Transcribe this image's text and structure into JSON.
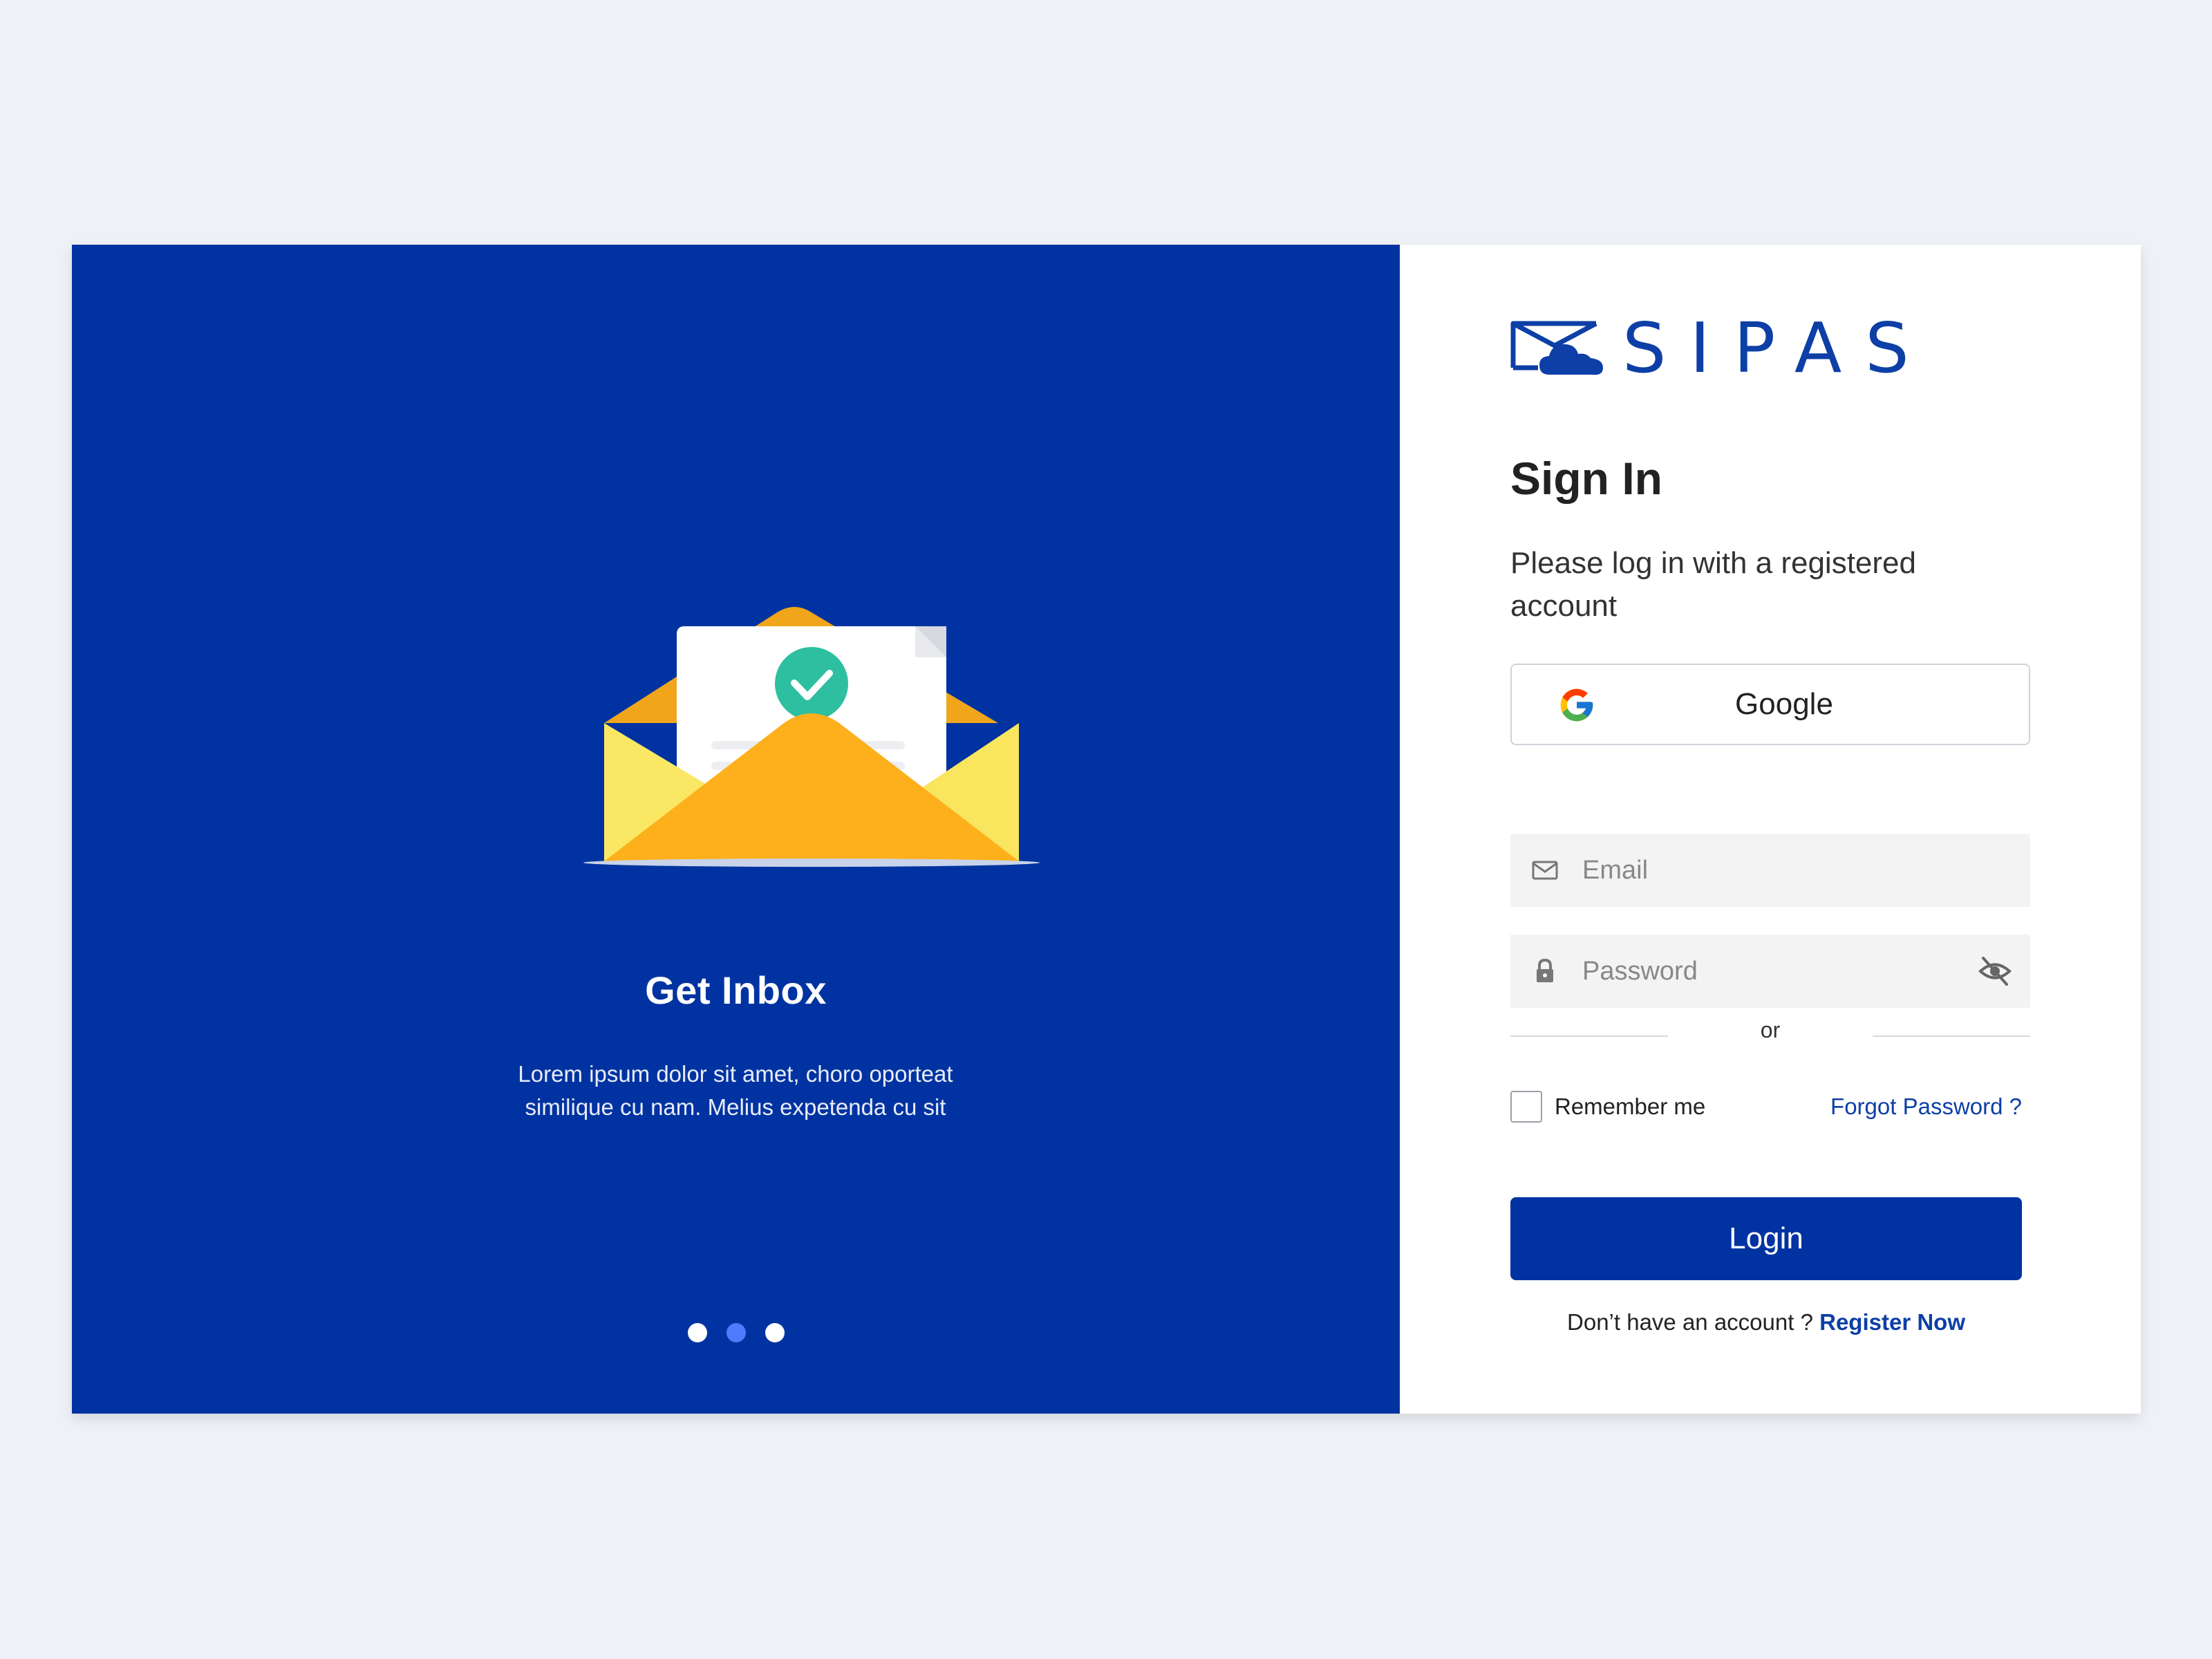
{
  "brand": {
    "name": "SIPAS",
    "primary_color": "#0033a1",
    "logo_icon": "envelope-cloud-icon"
  },
  "hero": {
    "title": "Get Inbox",
    "description": "Lorem ipsum dolor sit amet, choro oporteat similique cu nam. Melius expetenda cu sit",
    "illustration_icon": "open-envelope-check-icon",
    "carousel": {
      "slides": 3,
      "active_index": 1
    }
  },
  "signin": {
    "title": "Sign In",
    "subtitle": "Please log in with a registered account",
    "google_label": "Google",
    "divider_text": "or",
    "email_placeholder": "Email",
    "password_placeholder": "Password",
    "remember_label": "Remember me",
    "forgot_label": "Forgot Password ?",
    "login_label": "Login",
    "register_prompt": "Don’t have an account ? ",
    "register_link": "Register Now"
  }
}
